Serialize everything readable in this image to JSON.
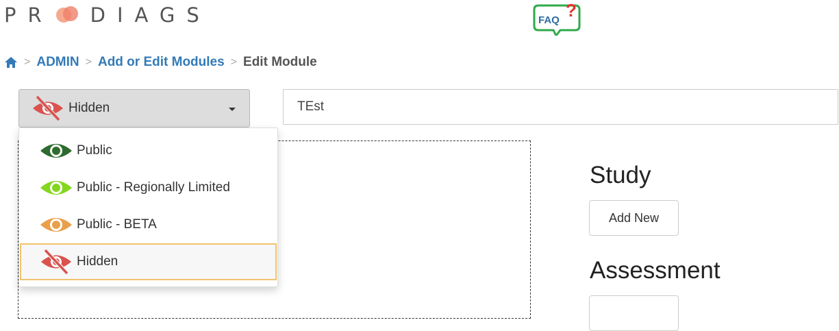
{
  "brand": {
    "logo_text_before": "PR",
    "logo_text_after": "DIAGS",
    "faq_label": "FAQ"
  },
  "breadcrumb": {
    "home_icon": "home-icon",
    "items": [
      {
        "label": "ADMIN"
      },
      {
        "label": "Add or Edit Modules"
      },
      {
        "label": "Edit Module"
      }
    ]
  },
  "visibility_select": {
    "selected_label": "Hidden",
    "selected_icon": "eye-slash-icon",
    "options": [
      {
        "label": "Public",
        "icon": "eye-icon",
        "color": "#2e6b2e"
      },
      {
        "label": "Public - Regionally Limited",
        "icon": "eye-icon",
        "color": "#84d61e"
      },
      {
        "label": "Public - BETA",
        "icon": "eye-icon",
        "color": "#e9a04b"
      },
      {
        "label": "Hidden",
        "icon": "eye-slash-icon",
        "color": "#d9534f"
      }
    ]
  },
  "module_title_input": {
    "value": "TEst"
  },
  "sections": [
    {
      "title": "Study",
      "button_label": "Add New"
    },
    {
      "title": "Assessment",
      "button_label": ""
    }
  ],
  "colors": {
    "link": "#337ab7",
    "faq_green": "#2eaa4a",
    "faq_red": "#e5322b",
    "logo_orange": "#f08a6a"
  }
}
